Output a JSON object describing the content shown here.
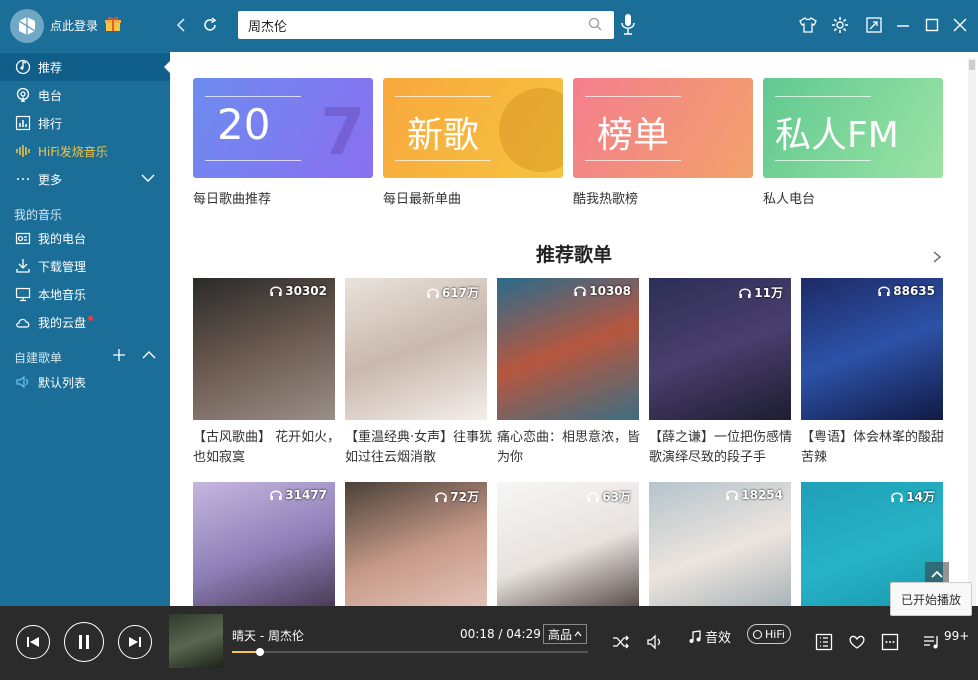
{
  "titlebar": {
    "login": "点此登录",
    "search_value": "周杰伦",
    "icons": [
      "back-icon",
      "refresh-icon",
      "search-icon",
      "mic-icon",
      "shirt-icon",
      "gear-icon",
      "mini-mode-icon",
      "minimize-icon",
      "maximize-icon",
      "close-icon"
    ]
  },
  "sidebar": {
    "nav": [
      {
        "label": "推荐",
        "icon": "disc-icon",
        "active": true
      },
      {
        "label": "电台",
        "icon": "radio-icon"
      },
      {
        "label": "排行",
        "icon": "chart-icon"
      },
      {
        "label": "HiFi发烧音乐",
        "icon": "waveform-icon",
        "color": "#f5c542"
      },
      {
        "label": "更多",
        "icon": "dots-icon"
      }
    ],
    "my_music_title": "我的音乐",
    "my_music": [
      {
        "label": "我的电台",
        "icon": "radio-box-icon"
      },
      {
        "label": "下载管理",
        "icon": "download-icon"
      },
      {
        "label": "本地音乐",
        "icon": "monitor-icon"
      },
      {
        "label": "我的云盘",
        "icon": "cloud-icon"
      }
    ],
    "playlist_title": "自建歌单",
    "playlists": [
      {
        "label": "默认列表",
        "icon": "speaker-icon"
      }
    ]
  },
  "main": {
    "cards": [
      {
        "text": "20",
        "caption": "每日歌曲推荐",
        "bg": "linear-gradient(120deg,#6d8cf0,#8a6ff0)"
      },
      {
        "text": "新歌",
        "caption": "每日最新单曲",
        "bg": "linear-gradient(120deg,#f9a83d,#f4c43f)"
      },
      {
        "text": "榜单",
        "caption": "酷我热歌榜",
        "bg": "linear-gradient(120deg,#f47e8e,#f2a26b)"
      },
      {
        "text": "私人FM",
        "caption": "私人电台",
        "bg": "linear-gradient(120deg,#61c990,#9be3a5)"
      }
    ],
    "section_title": "推荐歌单",
    "playlists": [
      {
        "plays": "30302",
        "title": "【古风歌曲】 花开如火，也如寂寞",
        "bg": "linear-gradient(160deg,#2a2a2a,#6b5a50,#9a8e88)"
      },
      {
        "plays": "617万",
        "title": "【重温经典·女声】往事犹如过往云烟消散",
        "bg": "linear-gradient(160deg,#e9e2dc,#c9b8ad,#f3eeea)"
      },
      {
        "plays": "10308",
        "title": "痛心恋曲：相思意浓，皆为你",
        "bg": "linear-gradient(160deg,#2a6b8c,#b7573f,#3c6e82)"
      },
      {
        "plays": "11万",
        "title": "【薛之谦】一位把伤感情歌演绎尽致的段子手",
        "bg": "linear-gradient(160deg,#2c2f55,#4a3e6e,#1d1d30)"
      },
      {
        "plays": "88635",
        "title": "【粤语】体会林峯的酸甜苦辣",
        "bg": "linear-gradient(160deg,#1d2a66,#2d52a8,#111a44)"
      },
      {
        "plays": "31477",
        "title": "",
        "bg": "linear-gradient(160deg,#c5b7de,#8e7fb8,#3a2c40)"
      },
      {
        "plays": "72万",
        "title": "",
        "bg": "linear-gradient(160deg,#4a4038,#c79a88,#e8ccc2)"
      },
      {
        "plays": "63万",
        "title": "",
        "bg": "linear-gradient(160deg,#f6f6f6,#e8e2de,#3a2d2a)"
      },
      {
        "plays": "18254",
        "title": "",
        "bg": "linear-gradient(160deg,#b5c4cc,#ece4de,#9aa9b0)"
      },
      {
        "plays": "14万",
        "title": "",
        "bg": "linear-gradient(160deg,#1fa0b8,#27b3c6,#1592a8)"
      }
    ]
  },
  "player": {
    "song": "晴天 - 周杰伦",
    "time": "00:18 / 04:29",
    "quality": "高品",
    "progress": 0.08,
    "effect": "音效",
    "hifi": "HiFi",
    "queue_count": "99+",
    "tooltip": "已开始播放"
  }
}
